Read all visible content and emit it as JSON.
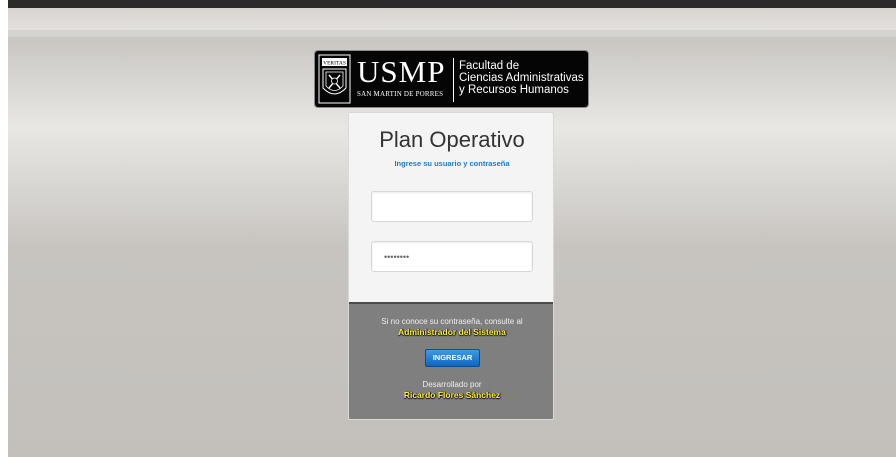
{
  "logo": {
    "brand": "USMP",
    "university": "SAN MARTIN DE PORRES",
    "faculty_line1": "Facultad de",
    "faculty_line2": "Ciencias Administrativas",
    "faculty_line3": "y Recursos Humanos",
    "shield_motto": "VERITAS"
  },
  "login": {
    "title": "Plan Operativo",
    "subtitle": "Ingrese su usuario y contraseña",
    "username_value": "",
    "password_value": "••••••••"
  },
  "footer": {
    "hint": "Si no conoce su contraseña, consulte al",
    "admin_link": "Administrador del Sistema",
    "submit_label": "INGRESAR",
    "developed_by": "Desarrollado por",
    "author": "Ricardo Flores Sánchez"
  },
  "colors": {
    "accent": "#1e7bc6",
    "highlight": "#ffee35",
    "footer_bg": "#7f7f7f"
  }
}
